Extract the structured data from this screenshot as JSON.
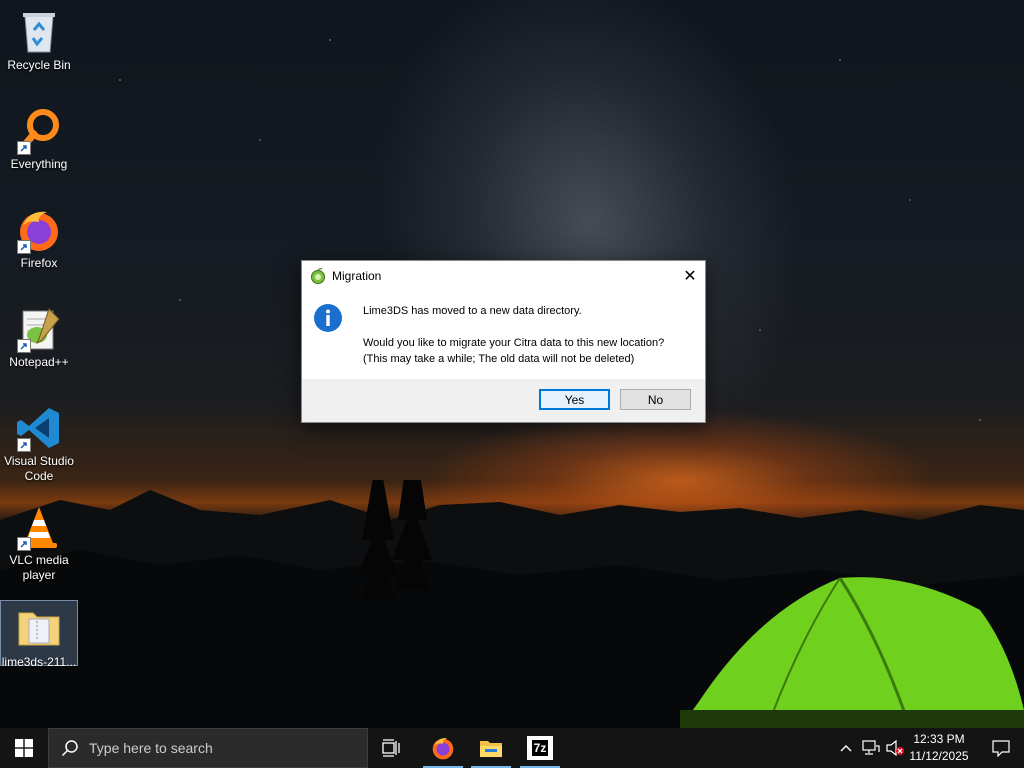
{
  "desktop": {
    "icons": [
      {
        "label": "Recycle Bin"
      },
      {
        "label": "Everything"
      },
      {
        "label": "Firefox"
      },
      {
        "label": "Notepad++"
      },
      {
        "label": "Visual Studio Code"
      },
      {
        "label": "VLC media player"
      },
      {
        "label": "lime3ds-211..."
      }
    ]
  },
  "dialog": {
    "title": "Migration",
    "message_line1": "Lime3DS has moved to a new data directory.",
    "message_line2": "Would you like to migrate your Citra data to this new location?",
    "message_line3": "(This may take a while; The old data will not be deleted)",
    "yes_label": "Yes",
    "no_label": "No",
    "close_glyph": "✕",
    "icon": "info-icon"
  },
  "taskbar": {
    "search_placeholder": "Type here to search",
    "pinned": [
      "task-view-icon",
      "firefox-icon",
      "file-explorer-icon",
      "7zip-icon"
    ],
    "sevenzip_label": "7z",
    "clock_time": "12:33 PM",
    "clock_date": "11/12/2025",
    "accent_color": "#0078d7"
  }
}
